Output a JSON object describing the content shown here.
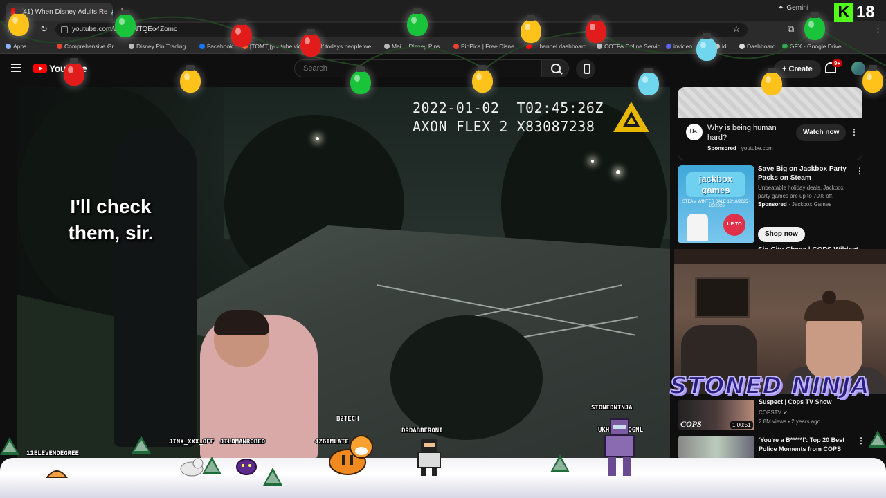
{
  "browser": {
    "tab_title": "(41) When Disney Adults Re",
    "tab_close": "✕",
    "new_tab": "+",
    "gemini_label": "Gemini",
    "url": "youtube.com/w…=kNTQEo4Zomc",
    "bookmarks": [
      {
        "label": "Apps",
        "color": "#8ab4f8"
      },
      {
        "label": "Comprehensive Gr…",
        "color": "#e94235"
      },
      {
        "label": "Disney Pin Trading…",
        "color": "#bbbbbb"
      },
      {
        "label": "Facebook",
        "color": "#1877f2"
      },
      {
        "label": "[TOMT][youtube vid…",
        "color": "#ff4500"
      },
      {
        "label": "If todays people we…",
        "color": "#bbbbbb"
      },
      {
        "label": "Mai… Disney Pins…",
        "color": "#bbbbbb"
      },
      {
        "label": "PinPics | Free Disne…",
        "color": "#e94235"
      },
      {
        "label": "…hannel dashboard",
        "color": "#ff0000"
      },
      {
        "label": "COTFA Online Servic…",
        "color": "#bbbbbb"
      },
      {
        "label": "invideo",
        "color": "#5865f2"
      },
      {
        "label": "id…",
        "color": "#bbbbbb"
      },
      {
        "label": "Dashboard",
        "color": "#dddddd"
      },
      {
        "label": "GFX - Google Drive",
        "color": "#34a853"
      }
    ]
  },
  "youtube": {
    "logo_text": "YouTube",
    "search_placeholder": "Search",
    "create_label": "Create",
    "notif_count": "9+"
  },
  "video": {
    "timestamp_line1": "2022-01-02  T02:45:26Z",
    "timestamp_line2": "AXON FLEX 2 X83087238",
    "caption": "I'll check them, sir."
  },
  "sidebar": {
    "ad1": {
      "logo": "Us.",
      "title": "Why is being human hard?",
      "sponsored": "Sponsored",
      "source": "youtube.com",
      "button": "Watch now"
    },
    "ad2": {
      "image_title": "jackbox games",
      "image_sub": "STEAM WINTER SALE 12/18/2025 - 1/5/2026",
      "image_badge": "UP TO 70% OFF",
      "title": "Save Big on Jackbox Party Packs on Steam",
      "desc": "Unbeatable holiday deals. Jackbox party games are up to 70% off.",
      "sponsored": "Sponsored",
      "source": "Jackbox Games",
      "button": "Shop now"
    },
    "cut_title": "Sin City Chase | COPS Wildest",
    "rel1": {
      "thumb_text": "COPS",
      "duration": "1:00:51",
      "title": "Suspect | Cops TV Show",
      "channel": "COPSTV",
      "meta": "2.8M views • 2 years ago"
    },
    "rel2": {
      "title": "'You're a B*****!': Top 20 Best Police Moments from COPS"
    }
  },
  "overlay": {
    "stream_title": "STONED NINJA",
    "kick_logo": "K",
    "kick_count": "18",
    "chatters": [
      "11ELEVENDEGREE",
      "JINX_XXX_OFF",
      "JILDMANROBED",
      "B2TECH",
      "4Z6IMLATE",
      "DRDABBERONI",
      "STONEDNINJA",
      "UKHEDGEHOGNL"
    ]
  },
  "colors": {
    "yt_bg": "#0f0f0f",
    "yt_red": "#ff0000",
    "kick_green": "#53fc18",
    "bulb_red": "#e21b1b",
    "bulb_green": "#19c43a",
    "bulb_yellow": "#ffc21a",
    "bulb_blue": "#6fd6ee"
  }
}
